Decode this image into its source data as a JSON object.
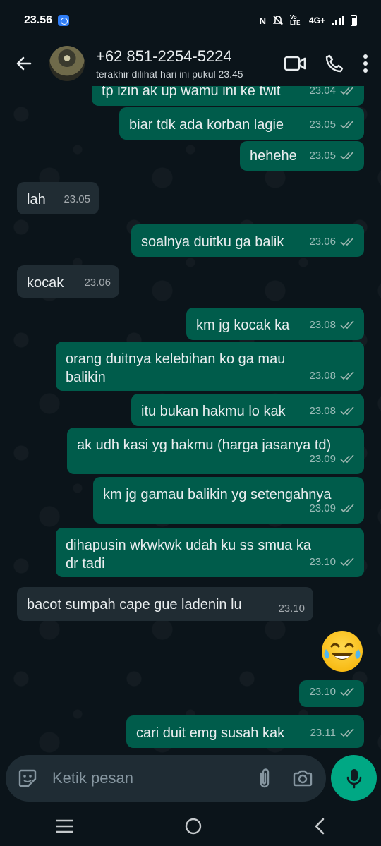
{
  "status_bar": {
    "time": "23.56",
    "network_label": "4G+",
    "volte_label": "Vo LTE"
  },
  "header": {
    "contact_name": "+62 851-2254-5224",
    "last_seen": "terakhir dilihat hari ini pukul 23.45"
  },
  "messages": [
    {
      "direction": "out",
      "text": "tp izin ak up wamu ini ke twit",
      "time": "23.04",
      "status": "read"
    },
    {
      "direction": "out",
      "text": "biar tdk ada korban lagie",
      "time": "23.05",
      "status": "read"
    },
    {
      "direction": "out",
      "text": "hehehe",
      "time": "23.05",
      "status": "read"
    },
    {
      "direction": "in",
      "text": "lah",
      "time": "23.05"
    },
    {
      "direction": "out",
      "text": "soalnya duitku ga balik",
      "time": "23.06",
      "status": "read"
    },
    {
      "direction": "in",
      "text": "kocak",
      "time": "23.06"
    },
    {
      "direction": "out",
      "text": "km jg kocak ka",
      "time": "23.08",
      "status": "read"
    },
    {
      "direction": "out",
      "text_line1": "orang duitnya kelebihan ko ga mau",
      "text_line2": "balikin",
      "time": "23.08",
      "status": "read"
    },
    {
      "direction": "out",
      "text": "itu bukan hakmu lo kak",
      "time": "23.08",
      "status": "read"
    },
    {
      "direction": "out",
      "text": "ak udh kasi yg hakmu (harga jasanya td)",
      "time": "23.09",
      "status": "read"
    },
    {
      "direction": "out",
      "text": "km jg gamau balikin yg setengahnya",
      "time": "23.09",
      "status": "read"
    },
    {
      "direction": "out",
      "text_line1": "dihapusin wkwkwk udah ku ss smua ka",
      "text_line2": "dr tadi",
      "time": "23.10",
      "status": "read"
    },
    {
      "direction": "in",
      "text": "bacot sumpah cape gue ladenin lu",
      "time": "23.10"
    },
    {
      "direction": "out",
      "emoji": "face-with-tears-of-joy",
      "time": "23.10",
      "status": "read"
    },
    {
      "direction": "out",
      "text": "cari duit emg susah kak",
      "time": "23.11",
      "status": "read"
    }
  ],
  "composer": {
    "placeholder": "Ketik pesan"
  },
  "colors": {
    "background": "#0b141a",
    "outgoing_bubble": "#005c4b",
    "incoming_bubble": "#202c33",
    "accent": "#00a884"
  }
}
